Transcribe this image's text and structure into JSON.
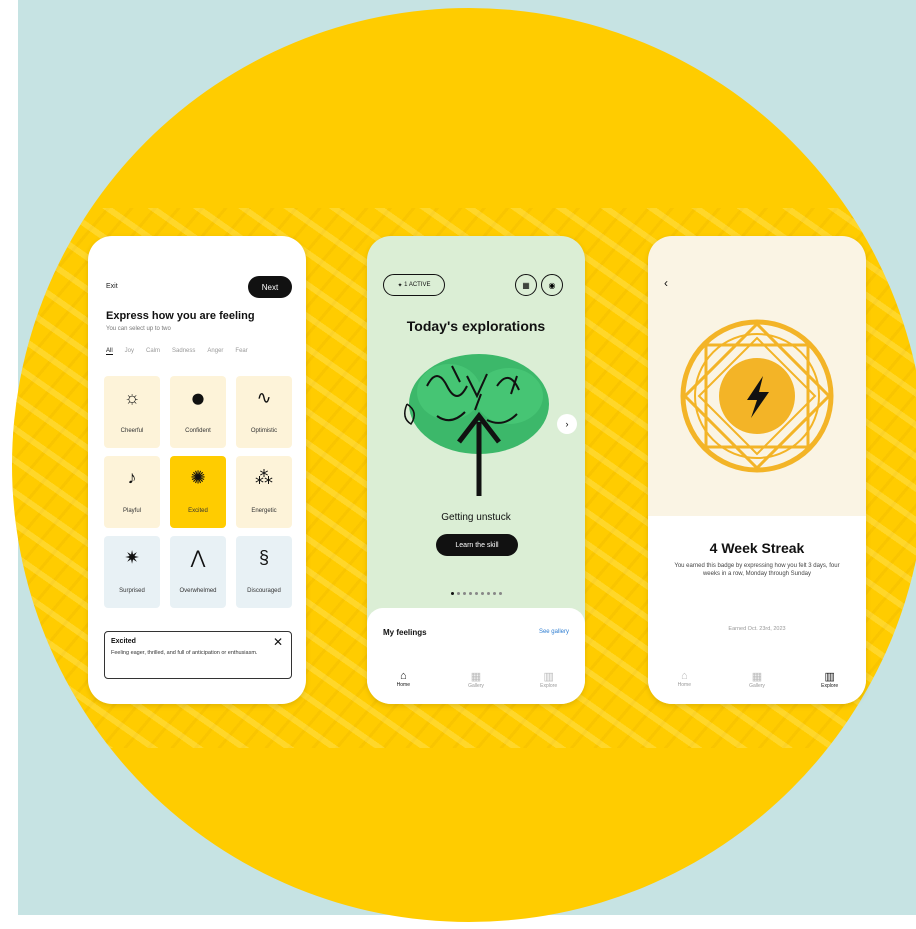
{
  "screen1": {
    "exit_label": "Exit",
    "next_label": "Next",
    "title": "Express how you are feeling",
    "subtitle": "You can select up to two",
    "tabs": [
      "All",
      "Joy",
      "Calm",
      "Sadness",
      "Anger",
      "Fear"
    ],
    "emotions": [
      {
        "label": "Cheerful",
        "icon": "cheerful-doodle",
        "glyph": "☼"
      },
      {
        "label": "Confident",
        "icon": "confident-blob",
        "glyph": "●"
      },
      {
        "label": "Optimistic",
        "icon": "optimistic-squiggle",
        "glyph": "∿"
      },
      {
        "label": "Playful",
        "icon": "playful-loop",
        "glyph": "♪"
      },
      {
        "label": "Excited",
        "icon": "excited-burst",
        "glyph": "✺"
      },
      {
        "label": "Energetic",
        "icon": "energetic-sprouts",
        "glyph": "⁂"
      },
      {
        "label": "Surprised",
        "icon": "surprised-scribble",
        "glyph": "✷"
      },
      {
        "label": "Overwhelmed",
        "icon": "overwhelmed-spikes",
        "glyph": "⋀"
      },
      {
        "label": "Discouraged",
        "icon": "discouraged-coil",
        "glyph": "§"
      }
    ],
    "tooltip": {
      "title": "Excited",
      "description": "Feeling eager, thrilled, and full of anticipation or enthusiasm."
    }
  },
  "screen2": {
    "active_label": "1 ACTIVE",
    "title": "Today's explorations",
    "exploration_title": "Getting unstuck",
    "cta_label": "Learn the skill",
    "carousel_pages": 9,
    "feelings_title": "My feelings",
    "see_gallery_label": "See gallery",
    "nav": [
      {
        "label": "Home",
        "icon": "home-icon",
        "glyph": "⌂"
      },
      {
        "label": "Gallery",
        "icon": "gallery-icon",
        "glyph": "▦"
      },
      {
        "label": "Explore",
        "icon": "explore-icon",
        "glyph": "▥"
      }
    ]
  },
  "screen3": {
    "title": "4 Week Streak",
    "description": "You earned this badge by expressing how you felt 3 days, four weeks in a row, Monday through Sunday",
    "earned_label": "Earned Oct. 23rd, 2023",
    "nav": [
      {
        "label": "Home",
        "icon": "home-icon",
        "glyph": "⌂"
      },
      {
        "label": "Gallery",
        "icon": "gallery-icon",
        "glyph": "▦"
      },
      {
        "label": "Explore",
        "icon": "explore-icon",
        "glyph": "▥"
      }
    ]
  },
  "colors": {
    "background": "#c6e3e3",
    "circle": "#ffcc00",
    "selected": "#ffcc00",
    "tree_green": "#3cb86a",
    "badge_gold": "#f3b427",
    "link_blue": "#2e7dd1"
  }
}
